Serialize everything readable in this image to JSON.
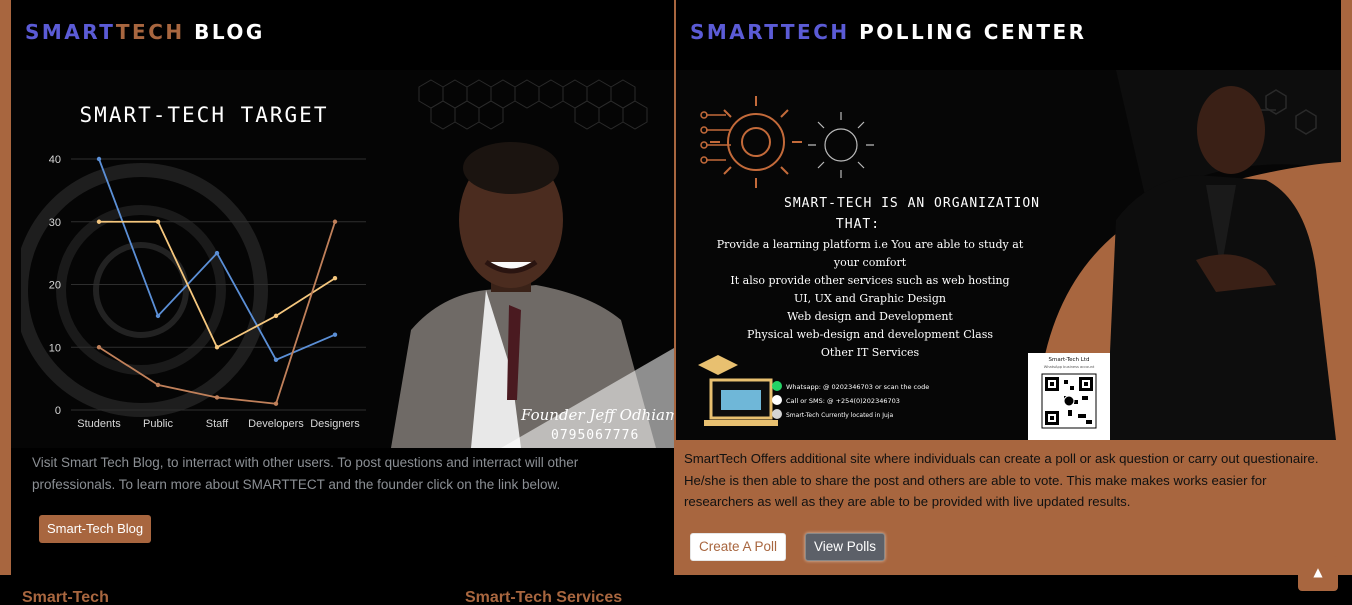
{
  "blog": {
    "heading": {
      "smart": "SMART",
      "tech": "TECH",
      "rest": " BLOG"
    },
    "description": "Visit Smart Tech Blog, to interract with other users. To post questions and interract will other professionals. To learn more about SMARTTECT and the founder click on the link below.",
    "button_label": "Smart-Tech Blog",
    "image": {
      "founder_caption": "Founder Jeff Odhiambo",
      "founder_phone": "0795067776"
    }
  },
  "chart_data": {
    "type": "line",
    "title": "SMART-TECH TARGET",
    "categories": [
      "Students",
      "Public",
      "Staff",
      "Developers",
      "Designers"
    ],
    "series": [
      {
        "values": [
          40,
          15,
          25,
          8,
          12
        ],
        "color": "#5b8fd6"
      },
      {
        "values": [
          30,
          30,
          10,
          15,
          21
        ],
        "color": "#f5c77e"
      },
      {
        "values": [
          10,
          4,
          2,
          1,
          30
        ],
        "color": "#c0805a"
      }
    ],
    "ylim": [
      0,
      40
    ],
    "yticks": [
      "0",
      "10",
      "20",
      "30",
      "40"
    ],
    "grid": true
  },
  "polling": {
    "heading": {
      "smart": "SMARTTECH",
      "rest": " POLLING CENTER"
    },
    "description": "SmartTech Offers additional site where individuals can create a poll or ask question or carry out questionaire. He/she is then able to share the post and others are able to vote. This make makes works easier for researchers as well as they are able to be provided with live updated results.",
    "create_label": "Create A Poll",
    "view_label": "View Polls",
    "image": {
      "headline_1": "SMART-TECH IS AN ORGANIZATION",
      "headline_2": "THAT:",
      "lines": [
        "Provide a learning platform i.e You are able to study at",
        "your comfort",
        "It also provide other services such as web hosting",
        "UI, UX and Graphic Design",
        "Web design and Development",
        "Physical web-design and development Class",
        "Other IT Services"
      ],
      "contact_whatsapp": "Whatsapp: @ 0202346703 or scan the code",
      "contact_call": "Call or SMS: @ +254(0)202346703",
      "contact_location": "Smart-Tech Currently located in Juja",
      "qr_title": "Smart-Tech Ltd",
      "qr_subtitle": "WhatsApp business account"
    }
  },
  "footer": {
    "col1_title": "Smart-Tech",
    "col2_title": "Smart-Tech Services"
  },
  "colors": {
    "accent": "#a8663f",
    "brand_blue": "#5b5bd6"
  },
  "icons": {
    "back_to_top": "chevron-up-icon"
  }
}
